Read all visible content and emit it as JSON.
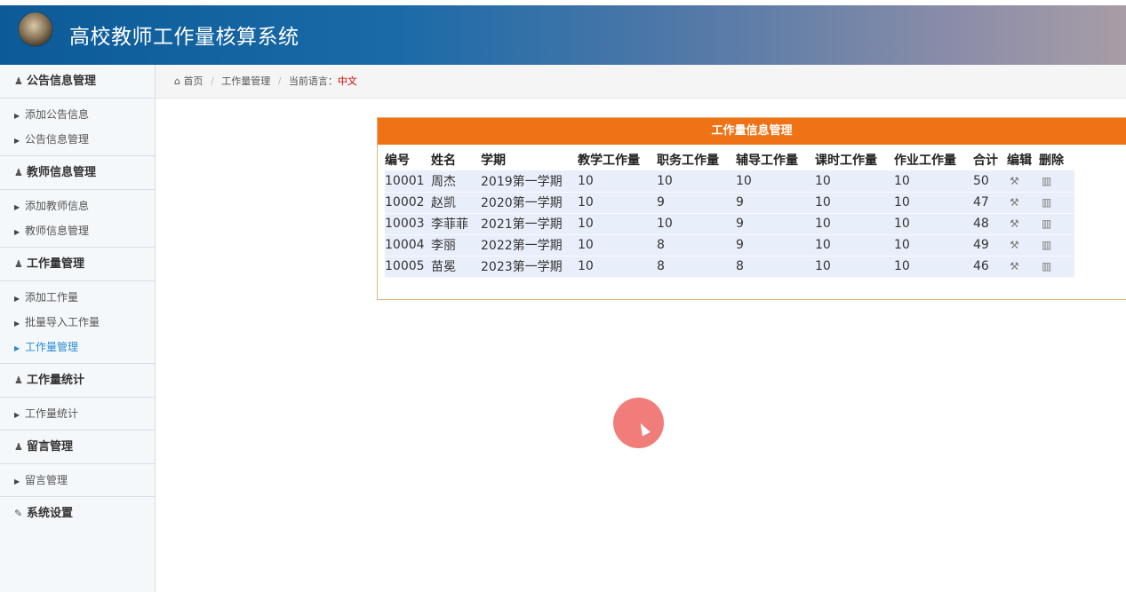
{
  "app": {
    "title": "高校教师工作量核算系统"
  },
  "sidebar": {
    "groups": [
      {
        "title": "公告信息管理",
        "items": [
          "添加公告信息",
          "公告信息管理"
        ]
      },
      {
        "title": "教师信息管理",
        "items": [
          "添加教师信息",
          "教师信息管理"
        ]
      },
      {
        "title": "工作量管理",
        "items": [
          "添加工作量",
          "批量导入工作量",
          "工作量管理"
        ]
      },
      {
        "title": "工作量统计",
        "items": [
          "工作量统计"
        ]
      },
      {
        "title": "留言管理",
        "items": [
          "留言管理"
        ]
      },
      {
        "title": "系统设置",
        "items": []
      }
    ],
    "active_item": "工作量管理"
  },
  "breadcrumb": {
    "home": "首页",
    "current": "工作量管理",
    "lang_label": "当前语言：",
    "lang_value": "中文"
  },
  "panel": {
    "title": "工作量信息管理",
    "columns": [
      "编号",
      "姓名",
      "学期",
      "教学工作量",
      "职务工作量",
      "辅导工作量",
      "课时工作量",
      "作业工作量",
      "合计",
      "编辑",
      "删除"
    ],
    "rows": [
      [
        "10001",
        "周杰",
        "2019第一学期",
        "10",
        "10",
        "10",
        "10",
        "10",
        "50"
      ],
      [
        "10002",
        "赵凯",
        "2020第一学期",
        "10",
        "9",
        "9",
        "10",
        "10",
        "47"
      ],
      [
        "10003",
        "李菲菲",
        "2021第一学期",
        "10",
        "10",
        "9",
        "10",
        "10",
        "48"
      ],
      [
        "10004",
        "李丽",
        "2022第一学期",
        "10",
        "8",
        "9",
        "10",
        "10",
        "49"
      ],
      [
        "10005",
        "苗冕",
        "2023第一学期",
        "10",
        "8",
        "8",
        "10",
        "10",
        "46"
      ]
    ]
  },
  "icons": {
    "group": "user-icon",
    "item": "triangle-right-icon",
    "settings": "edit-icon",
    "home": "home-icon",
    "edit": "wrench-icon",
    "delete": "trash-icon"
  },
  "colors": {
    "header_start": "#0c5b98",
    "panel_head": "#ef7316",
    "active_link": "#2a8ad4",
    "lang": "#d40000"
  }
}
